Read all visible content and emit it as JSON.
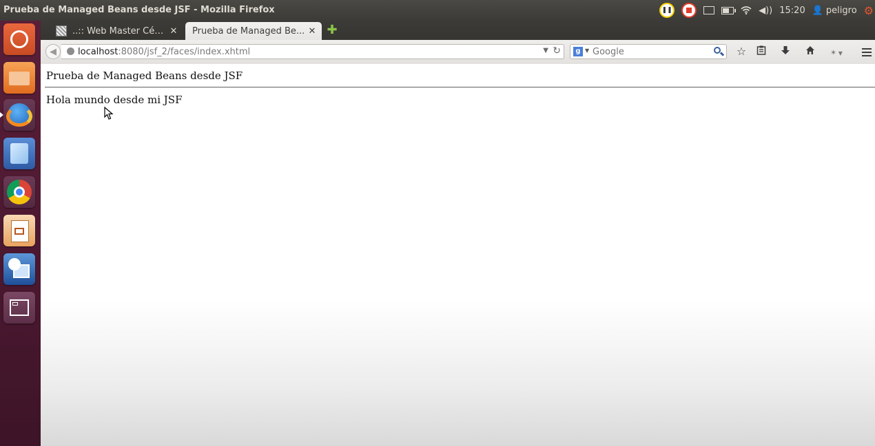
{
  "window": {
    "title": "Prueba de Managed Beans desde JSF - Mozilla Firefox"
  },
  "system_tray": {
    "clock": "15:20",
    "user": "peligro"
  },
  "launcher": {
    "items": [
      {
        "name": "dash-home"
      },
      {
        "name": "files"
      },
      {
        "name": "firefox"
      },
      {
        "name": "virtualbox"
      },
      {
        "name": "chrome"
      },
      {
        "name": "libreoffice-impress"
      },
      {
        "name": "openshot"
      },
      {
        "name": "workspace-switcher"
      }
    ]
  },
  "tabs": [
    {
      "label": "..:: Web Master Césa...",
      "active": false
    },
    {
      "label": "Prueba de Managed Be...",
      "active": true
    }
  ],
  "navbar": {
    "url_host": "localhost",
    "url_path": ":8080/jsf_2/faces/index.xhtml",
    "search_engine": "Google",
    "search_placeholder": "Google"
  },
  "page": {
    "heading": "Prueba de Managed Beans desde JSF",
    "message": "Hola mundo desde mi JSF"
  },
  "colors": {
    "panel": "#3c3b37",
    "launcher": "#4a1830",
    "tray_pause": "#f7d000",
    "tray_record": "#e23b2c",
    "session_gear": "#e8562f"
  }
}
